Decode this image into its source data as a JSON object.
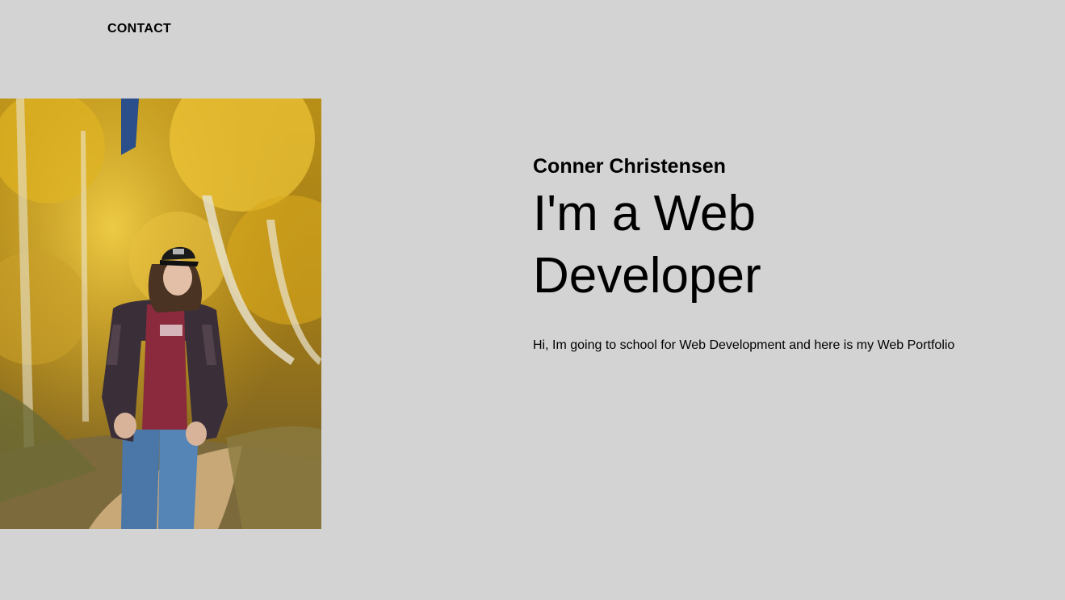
{
  "nav": {
    "contact_label": "CONTACT"
  },
  "hero": {
    "name": "Conner Christensen",
    "headline": "I'm a Web Developer",
    "description": "Hi, Im going to school for Web Development and here is my Web Portfolio"
  },
  "colors": {
    "background": "#d3d3d3",
    "text": "#000000"
  }
}
